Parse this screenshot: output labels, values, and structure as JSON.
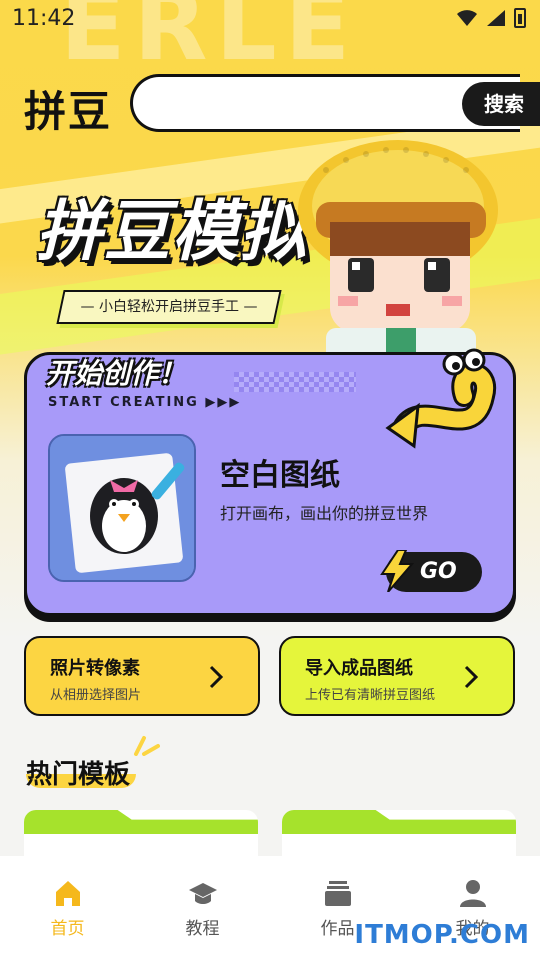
{
  "status_bar": {
    "time": "11:42"
  },
  "header": {
    "brand": "拼豆",
    "search_placeholder": "",
    "search_button": "搜索"
  },
  "hero": {
    "watermark": "ERLE",
    "title": "拼豆模拟",
    "subtitle": "— 小白轻松开启拼豆手工 —"
  },
  "create_card": {
    "label": "开始创作！",
    "sublabel": "START CREATING ▶▶▶",
    "title": "空白图纸",
    "description": "打开画布，画出你的拼豆世界",
    "go_button": "GO"
  },
  "quick_actions": [
    {
      "title": "照片转像素",
      "description": "从相册选择图片"
    },
    {
      "title": "导入成品图纸",
      "description": "上传已有清晰拼豆图纸"
    }
  ],
  "section": {
    "hot_templates": "热门模板"
  },
  "bottom_nav": [
    {
      "label": "首页",
      "icon": "home-icon",
      "active": true
    },
    {
      "label": "教程",
      "icon": "graduation-cap-icon",
      "active": false
    },
    {
      "label": "作品",
      "icon": "stack-icon",
      "active": false
    },
    {
      "label": "我的",
      "icon": "user-icon",
      "active": false
    }
  ],
  "watermark": "ITMOP.COM",
  "colors": {
    "accent_yellow": "#fcd542",
    "accent_lime": "#e5f53b",
    "card_purple": "#a89af9",
    "nav_active": "#f5b81c"
  }
}
